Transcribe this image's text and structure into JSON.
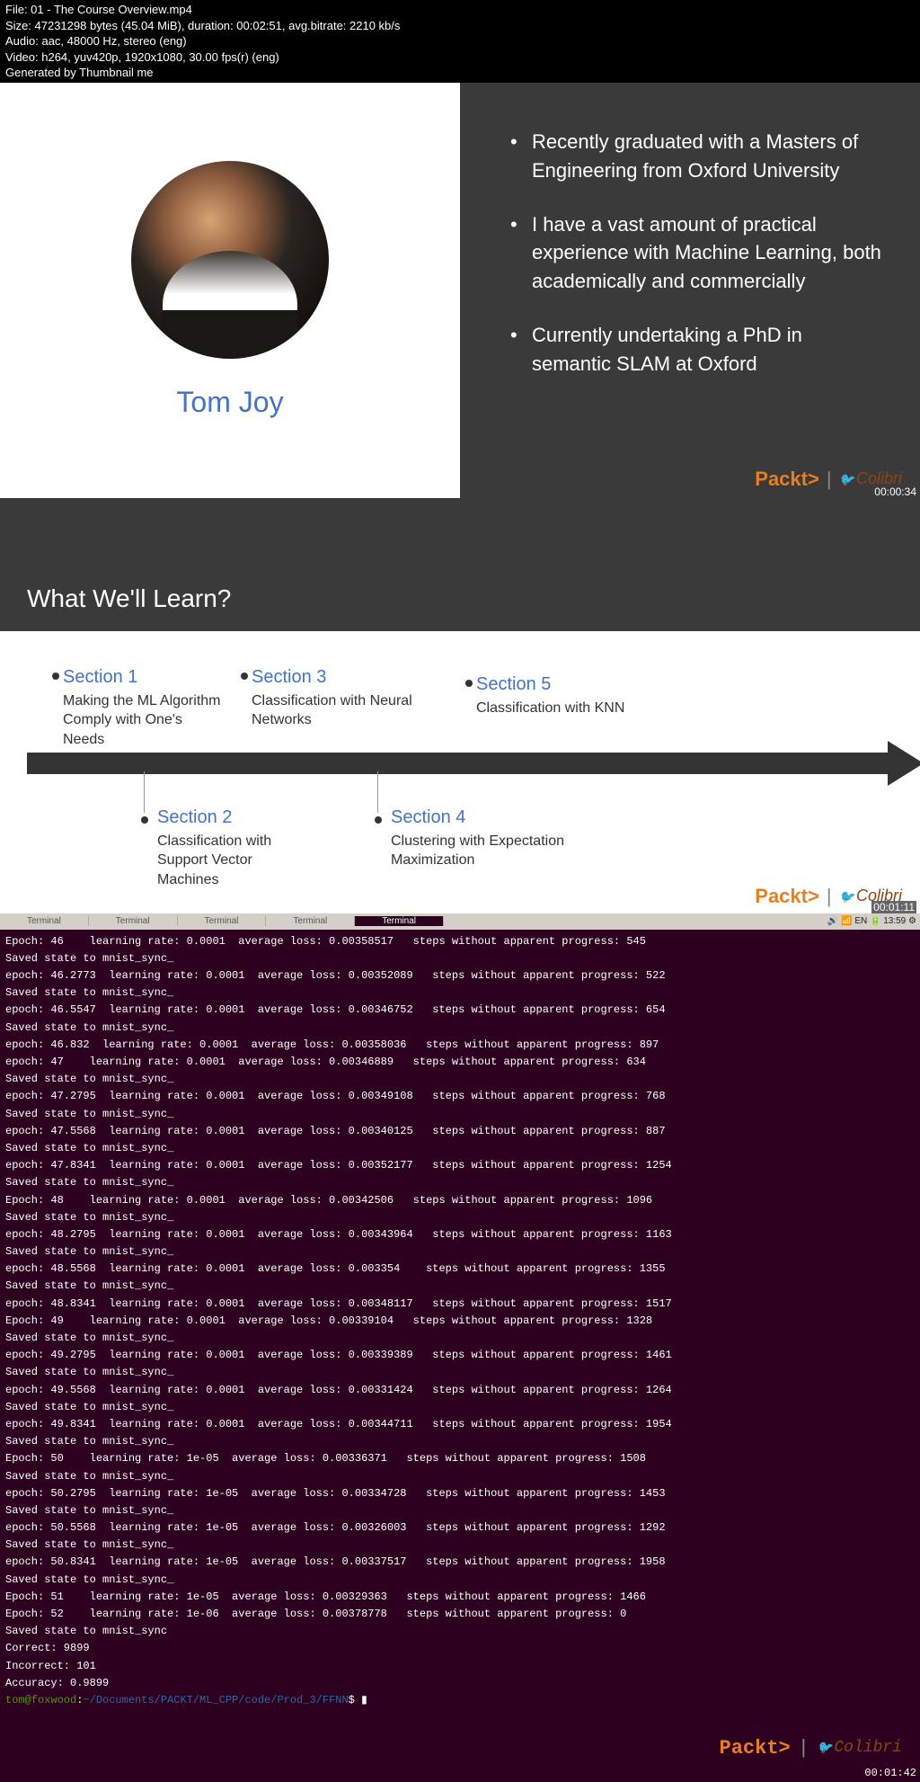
{
  "header": {
    "file": "File: 01 - The Course Overview.mp4",
    "size": "Size: 47231298 bytes (45.04 MiB), duration: 00:02:51, avg.bitrate: 2210 kb/s",
    "audio": "Audio: aac, 48000 Hz, stereo (eng)",
    "video": "Video: h264, yuv420p, 1920x1080, 30.00 fps(r) (eng)",
    "gen": "Generated by Thumbnail me"
  },
  "slide1": {
    "author": "Tom Joy",
    "bullets": [
      "Recently graduated with a Masters of Engineering from Oxford University",
      "I have a vast amount of practical experience with Machine Learning, both academically and commercially",
      "Currently undertaking a PhD in semantic SLAM at Oxford"
    ],
    "ts": "00:00:34"
  },
  "brand": {
    "packt": "Packt>",
    "sep": "|",
    "colibri": "Colibri"
  },
  "slide2": {
    "title": "What We'll Learn?",
    "sections": [
      {
        "title": "Section 1",
        "desc": "Making the ML Algorithm Comply with One's Needs"
      },
      {
        "title": "Section 2",
        "desc": "Classification with Support Vector Machines"
      },
      {
        "title": "Section 3",
        "desc": "Classification with Neural Networks"
      },
      {
        "title": "Section 4",
        "desc": "Clustering with Expectation Maximization"
      },
      {
        "title": "Section 5",
        "desc": "Classification with KNN"
      }
    ],
    "ts": "00:01:11"
  },
  "terminal": {
    "tabs": [
      "Terminal",
      "Terminal",
      "Terminal",
      "Terminal",
      "Terminal"
    ],
    "tray": "🔊 📶 EN 🔋 13:59 ⚙",
    "lines": [
      "Epoch: 46    learning rate: 0.0001  average loss: 0.00358517   steps without apparent progress: 545",
      "Saved state to mnist_sync_",
      "epoch: 46.2773  learning rate: 0.0001  average loss: 0.00352089   steps without apparent progress: 522",
      "Saved state to mnist_sync_",
      "epoch: 46.5547  learning rate: 0.0001  average loss: 0.00346752   steps without apparent progress: 654",
      "Saved state to mnist_sync_",
      "epoch: 46.832  learning rate: 0.0001  average loss: 0.00358036   steps without apparent progress: 897",
      "epoch: 47    learning rate: 0.0001  average loss: 0.00346889   steps without apparent progress: 634",
      "Saved state to mnist_sync_",
      "epoch: 47.2795  learning rate: 0.0001  average loss: 0.00349108   steps without apparent progress: 768",
      "Saved state to mnist_sync_",
      "epoch: 47.5568  learning rate: 0.0001  average loss: 0.00340125   steps without apparent progress: 887",
      "Saved state to mnist_sync_",
      "epoch: 47.8341  learning rate: 0.0001  average loss: 0.00352177   steps without apparent progress: 1254",
      "Saved state to mnist_sync_",
      "Epoch: 48    learning rate: 0.0001  average loss: 0.00342506   steps without apparent progress: 1096",
      "Saved state to mnist_sync_",
      "epoch: 48.2795  learning rate: 0.0001  average loss: 0.00343964   steps without apparent progress: 1163",
      "Saved state to mnist_sync_",
      "epoch: 48.5568  learning rate: 0.0001  average loss: 0.003354    steps without apparent progress: 1355",
      "Saved state to mnist_sync_",
      "epoch: 48.8341  learning rate: 0.0001  average loss: 0.00348117   steps without apparent progress: 1517",
      "Epoch: 49    learning rate: 0.0001  average loss: 0.00339104   steps without apparent progress: 1328",
      "Saved state to mnist_sync_",
      "epoch: 49.2795  learning rate: 0.0001  average loss: 0.00339389   steps without apparent progress: 1461",
      "Saved state to mnist_sync_",
      "epoch: 49.5568  learning rate: 0.0001  average loss: 0.00331424   steps without apparent progress: 1264",
      "Saved state to mnist_sync_",
      "epoch: 49.8341  learning rate: 0.0001  average loss: 0.00344711   steps without apparent progress: 1954",
      "Saved state to mnist_sync_",
      "Epoch: 50    learning rate: 1e-05  average loss: 0.00336371   steps without apparent progress: 1508",
      "Saved state to mnist_sync_",
      "epoch: 50.2795  learning rate: 1e-05  average loss: 0.00334728   steps without apparent progress: 1453",
      "Saved state to mnist_sync_",
      "epoch: 50.5568  learning rate: 1e-05  average loss: 0.00326003   steps without apparent progress: 1292",
      "Saved state to mnist_sync_",
      "epoch: 50.8341  learning rate: 1e-05  average loss: 0.00337517   steps without apparent progress: 1958",
      "Saved state to mnist_sync_",
      "Epoch: 51    learning rate: 1e-05  average loss: 0.00329363   steps without apparent progress: 1466",
      "Epoch: 52    learning rate: 1e-06  average loss: 0.00378778   steps without apparent progress: 0",
      "Saved state to mnist_sync",
      "Correct: 9899",
      "Incorrect: 101",
      "Accuracy: 0.9899"
    ],
    "prompt_user": "tom@foxwood",
    "prompt_colon": ":",
    "prompt_path": "~/Documents/PACKT/ML_CPP/code/Prod_3/FFNN",
    "prompt_end": "$ ▮",
    "ts": "00:01:42"
  }
}
